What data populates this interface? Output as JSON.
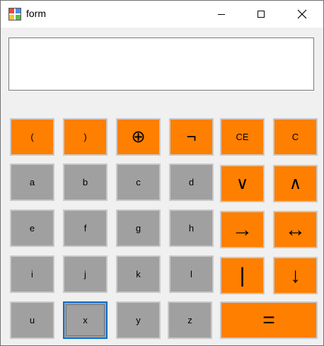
{
  "window": {
    "title": "form"
  },
  "display": {
    "value": ""
  },
  "colors": {
    "operator": "#ff7f00",
    "variable": "#a0a0a0",
    "focus": "#0a6ed1"
  },
  "keys": {
    "lparen": "(",
    "rparen": ")",
    "xor": "⊕",
    "not": "¬",
    "ce": "CE",
    "c": "C",
    "a": "a",
    "b": "b",
    "cc": "c",
    "d": "d",
    "or": "∨",
    "and": "∧",
    "e": "e",
    "f": "f",
    "g": "g",
    "h": "h",
    "implies": "→",
    "iff": "↔",
    "i": "i",
    "j": "j",
    "k": "k",
    "l": "l",
    "nand": "|",
    "nor": "↓",
    "u": "u",
    "x": "x",
    "y": "y",
    "z": "z",
    "equals": "="
  }
}
